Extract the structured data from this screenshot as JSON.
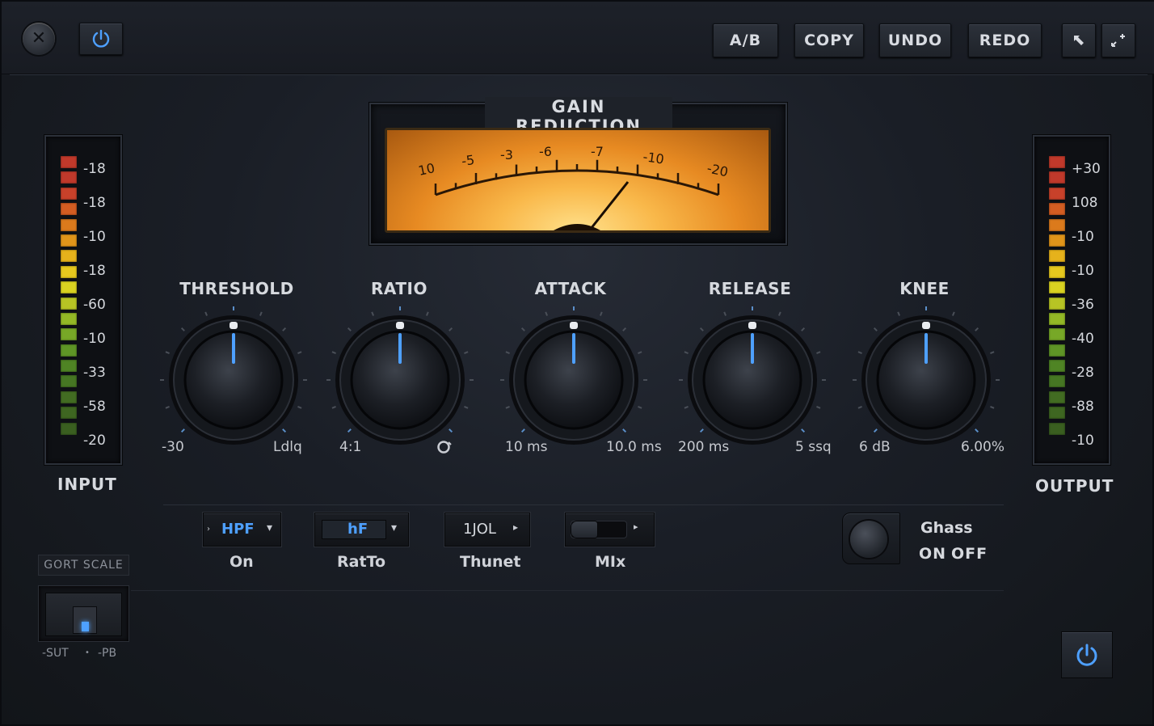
{
  "header": {
    "ab_label": "A/B",
    "copy_label": "COPY",
    "undo_label": "UNDO",
    "redo_label": "REDO"
  },
  "colors": {
    "accent": "#4ea0ff",
    "vu_amber": "#f9b84a",
    "panel": "#1e2229"
  },
  "icons": {
    "close": "close-icon",
    "power": "power-icon",
    "pin": "pin-icon",
    "expand": "expand-icon"
  },
  "input_meter": {
    "title": "INPUT",
    "labels": [
      "-18",
      "-18",
      "-10",
      "-18",
      "-60",
      "-10",
      "-33",
      "-58",
      "-20"
    ]
  },
  "output_meter": {
    "title": "OUTPUT",
    "labels": [
      "+30",
      "108",
      "-10",
      "-10",
      "-36",
      "-40",
      "-28",
      "-88",
      "-10"
    ]
  },
  "vu": {
    "title": "GAIN REDUCTION",
    "scale": [
      "10",
      "-5",
      "-3",
      "-6",
      "-7",
      "-10",
      "-20"
    ]
  },
  "knobs": [
    {
      "label": "THRESHOLD",
      "min": "-30",
      "max": "Ldlq"
    },
    {
      "label": "RATIO",
      "min": "4:1",
      "max": ""
    },
    {
      "label": "ATTACK",
      "min": "10 ms",
      "max": "10.0 ms"
    },
    {
      "label": "RELEASE",
      "min": "200 ms",
      "max": "5 ssq"
    },
    {
      "label": "KNEE",
      "min": "6 dB",
      "max": "6.00%"
    }
  ],
  "lower": {
    "filter_value": "HPF",
    "filter_label": "On",
    "ratio_value": "hF",
    "ratio_label": "RatTo",
    "thunet_value": "1JOL",
    "thunet_label": "Thunet",
    "mix_label": "MIx"
  },
  "ghass": {
    "title": "Ghass",
    "on": "ON",
    "off": "OFF"
  },
  "sort": {
    "title": "GORT SCALE",
    "left": "-SUT",
    "right": "-PB"
  }
}
